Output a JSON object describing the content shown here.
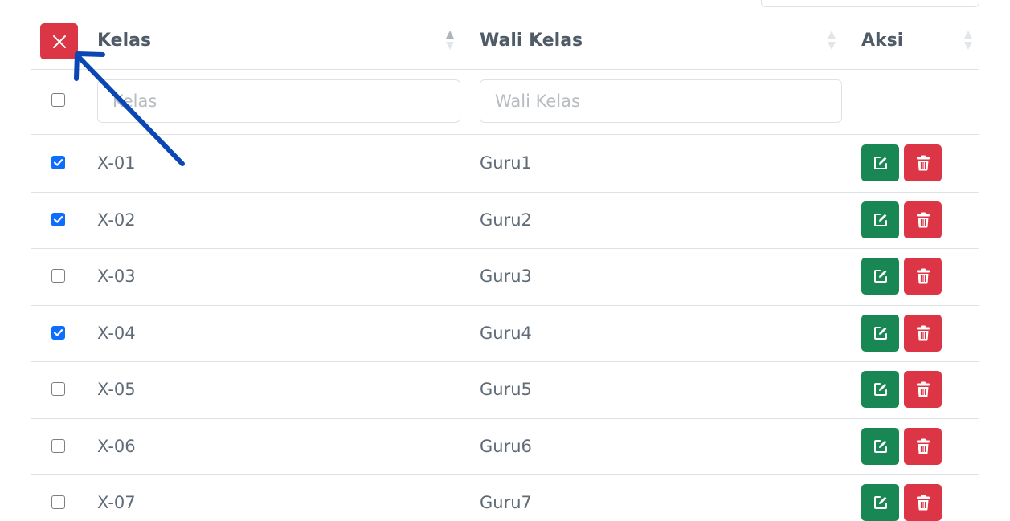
{
  "table": {
    "columns": [
      {
        "label": "Kelas",
        "sort": "asc"
      },
      {
        "label": "Wali Kelas",
        "sort": "none"
      },
      {
        "label": "Aksi",
        "sort": "none"
      }
    ],
    "filters": {
      "kelas_placeholder": "Kelas",
      "wali_placeholder": "Wali Kelas"
    },
    "select_all_checked": false,
    "rows": [
      {
        "kelas": "X-01",
        "wali": "Guru1",
        "checked": true
      },
      {
        "kelas": "X-02",
        "wali": "Guru2",
        "checked": true
      },
      {
        "kelas": "X-03",
        "wali": "Guru3",
        "checked": false
      },
      {
        "kelas": "X-04",
        "wali": "Guru4",
        "checked": true
      },
      {
        "kelas": "X-05",
        "wali": "Guru5",
        "checked": false
      },
      {
        "kelas": "X-06",
        "wali": "Guru6",
        "checked": false
      },
      {
        "kelas": "X-07",
        "wali": "Guru7",
        "checked": false
      }
    ]
  },
  "icons": {
    "clear_selection": "close-icon",
    "edit": "edit-icon",
    "delete": "trash-icon",
    "annotation": "arrow-annotation"
  },
  "colors": {
    "danger": "#dc3545",
    "success": "#198754",
    "checkbox_checked": "#0d6efd",
    "annotation": "#0a47b4"
  }
}
